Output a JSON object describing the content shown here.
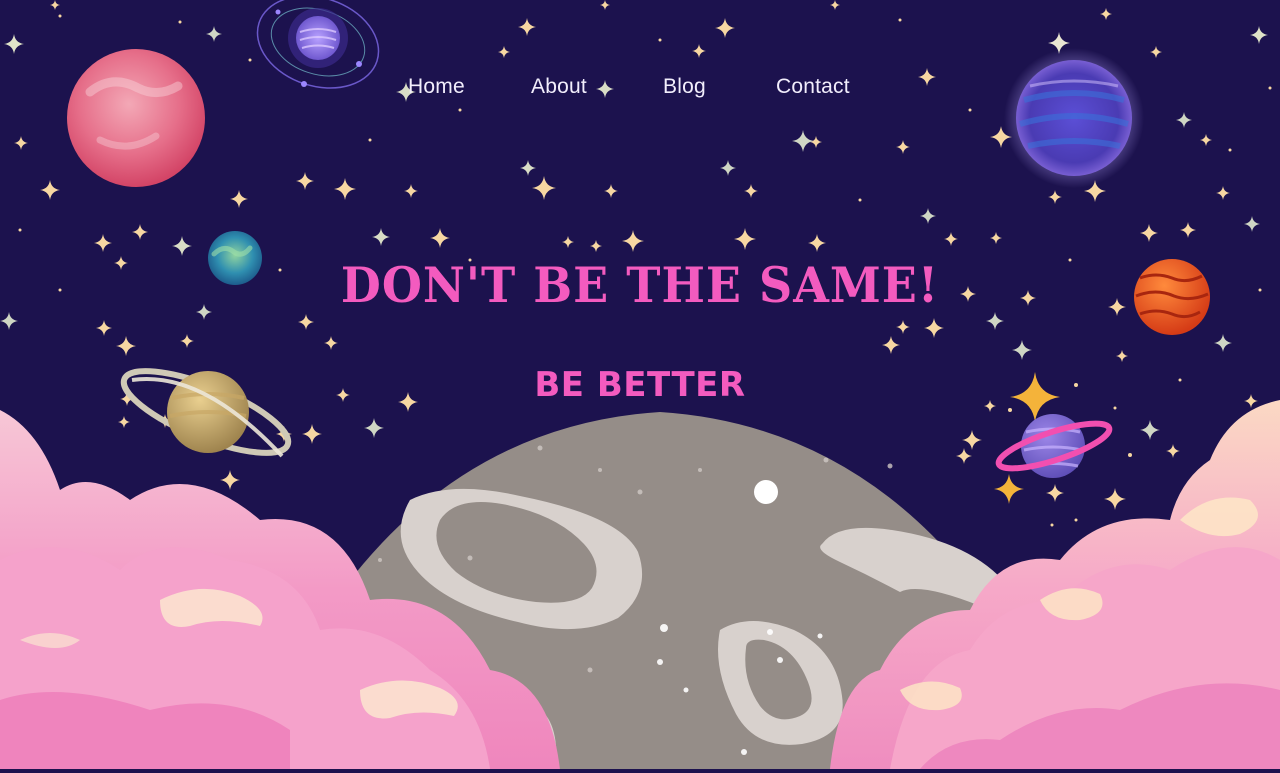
{
  "nav": {
    "home": "Home",
    "about": "About",
    "blog": "Blog",
    "contact": "Contact"
  },
  "hero": {
    "headline": "DON'T BE THE SAME!",
    "subheadline": "BE BETTER"
  },
  "colors": {
    "background": "#1c124e",
    "accent": "#f35bbf",
    "nav_text": "#f2eefc"
  }
}
